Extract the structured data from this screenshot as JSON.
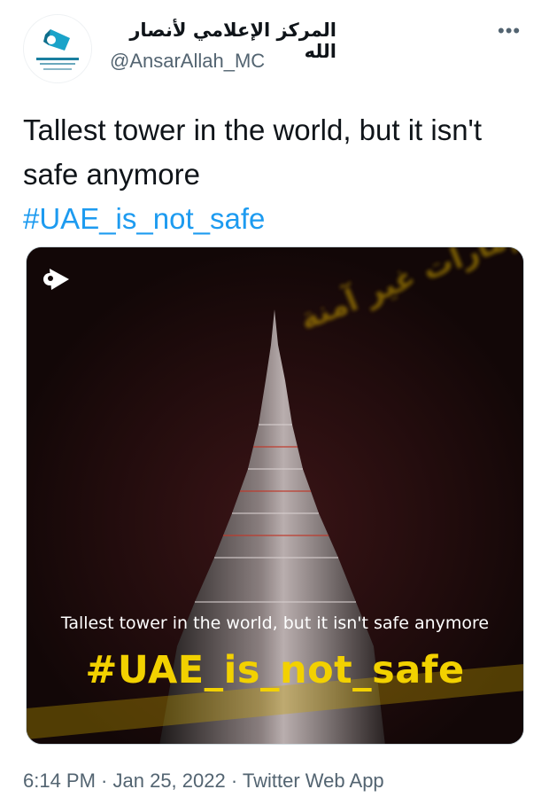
{
  "tweet": {
    "author": {
      "display_name": "المركز الإعلامي لأنصار الله",
      "handle": "@AnsarAllah_MC",
      "avatar_icon": "media-center-logo-icon"
    },
    "more_label": "•••",
    "text": "Tallest tower in the world, but it isn't safe anymore",
    "hashtag": "#UAE_is_not_safe",
    "media": {
      "caption": "Tallest tower in the world, but it isn't safe anymore",
      "hashtag": "#UAE_is_not_safe",
      "background_arabic": "الإمارات غير آمنة",
      "hashtag_color": "#f2d100"
    },
    "timestamp": {
      "time": "6:14 PM",
      "separator": " · ",
      "date": "Jan 25, 2022",
      "source": "Twitter Web App"
    }
  },
  "colors": {
    "link": "#1d9bf0",
    "secondary_text": "#536471",
    "primary_text": "#0f1419"
  }
}
